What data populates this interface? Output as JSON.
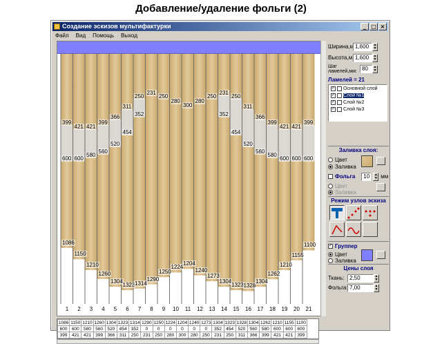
{
  "slide_title": "Добавление/удаление  фольги (2)",
  "window": {
    "title": "Создание эскизов мультифактурки",
    "controls": [
      "_",
      "□",
      "×"
    ],
    "menu": [
      "Файл",
      "Вид",
      "Помощь",
      "Выход"
    ]
  },
  "params": {
    "width_label": "Ширина,м:",
    "width_value": "1,600",
    "height_label": "Высота,м:",
    "height_value": "1,600",
    "step_label": "Шаг ламелей,мм:",
    "step_value": "80",
    "lamels_label": "Ламелей = 21"
  },
  "layers": [
    {
      "label": "Основной слой",
      "checked": true,
      "selected": false
    },
    {
      "label": "Слой №1",
      "checked": true,
      "selected": true
    },
    {
      "label": "Слой №2",
      "checked": true,
      "selected": false
    },
    {
      "label": "Слой №3",
      "checked": true,
      "selected": false
    }
  ],
  "fill": {
    "group_title": "Заливка слоя:",
    "opt_color": "Цвет",
    "opt_fill": "Заливка",
    "foil_label": "Фольга",
    "foil_value": "10",
    "foil_unit": "мм",
    "opt_color2": "Цвет",
    "opt_fill2": "Заливка"
  },
  "mode": {
    "group_title": "Режим узлов эскиза"
  },
  "grouper": {
    "label": "Группер",
    "opt_color": "Цвет",
    "opt_fill": "Заливка"
  },
  "prices": {
    "group_title": "Цены слоя",
    "fabric_label": "Ткань:",
    "fabric_value": "2,50",
    "foil_label": "Фольга:",
    "foil_value": "7,00"
  },
  "stripes": {
    "numbers": [
      "1",
      "2",
      "3",
      "4",
      "5",
      "6",
      "7",
      "8",
      "9",
      "10",
      "11",
      "12",
      "13",
      "14",
      "15",
      "16",
      "17",
      "18",
      "19",
      "20",
      "21"
    ],
    "bottom_values": [
      1086,
      1150,
      1210,
      1260,
      1304,
      1323,
      1314,
      1290,
      1250,
      1224,
      1204,
      1240,
      1273,
      1304,
      1323,
      1328,
      1304,
      1262,
      1210,
      1155,
      1100
    ],
    "mid_values": [
      600,
      600,
      580,
      560,
      520,
      454,
      352,
      0,
      0,
      0,
      0,
      0,
      0,
      352,
      454,
      520,
      560,
      580,
      600,
      600,
      600
    ],
    "top_values": [
      399,
      421,
      421,
      399,
      366,
      311,
      250,
      231,
      250,
      280,
      300,
      280,
      250,
      231,
      250,
      311,
      366,
      399,
      421,
      421,
      399
    ]
  },
  "colors": {
    "fabric": "#e2c99a",
    "fabric_dark": "#c9a86c",
    "foil": "#dcdcdc",
    "blue_bar": "#8080ff",
    "window_face": "#d4d0c8"
  }
}
